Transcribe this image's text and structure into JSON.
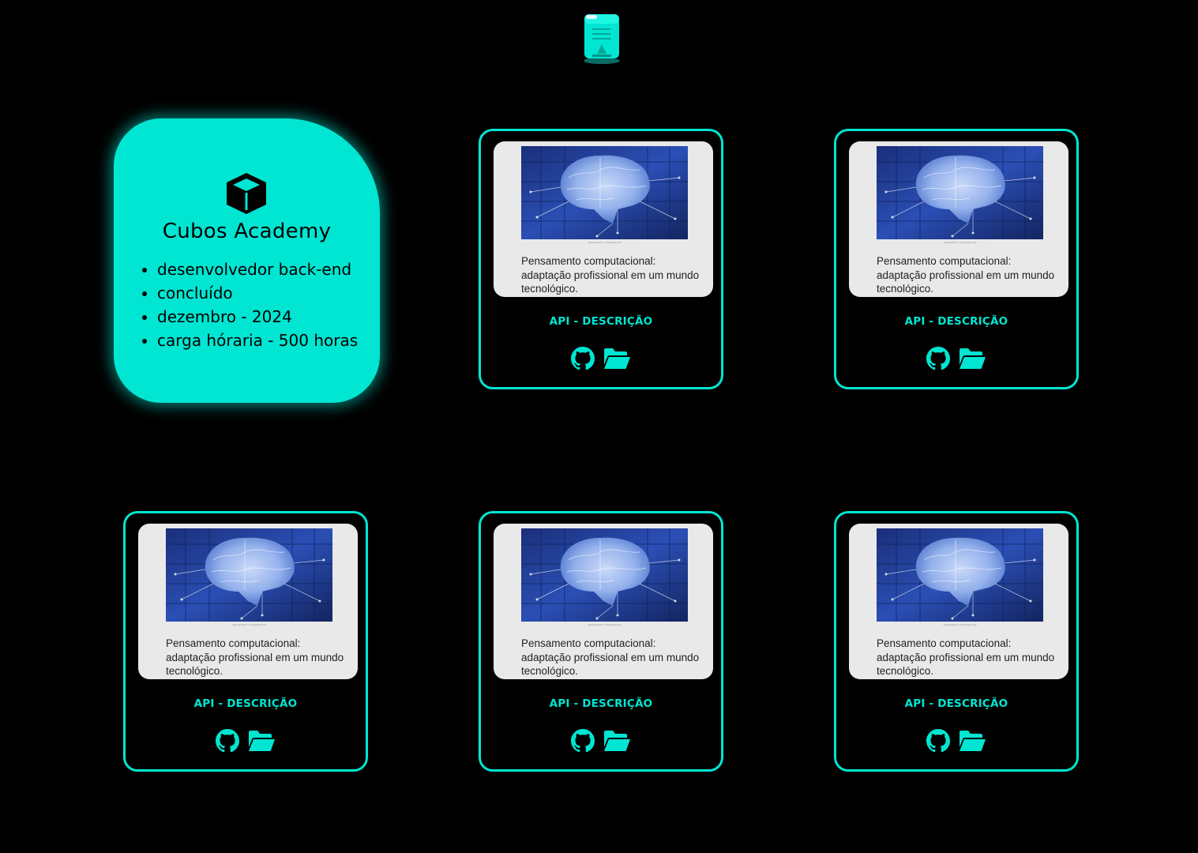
{
  "colors": {
    "background": "#000000",
    "accent": "#00e6d2",
    "text_dark": "#000000"
  },
  "header": {
    "logo_icon": "certificate-scroll-icon"
  },
  "course": {
    "icon": "cube-icon",
    "title": "Cubos Academy",
    "details": [
      "desenvolvedor back-end",
      "concluído",
      "dezembro - 2024",
      "carga hóraria - 500 horas"
    ]
  },
  "projects": [
    {
      "thumbnail_caption": "Pensamento computacional: adaptação profissional em um mundo tecnológico.",
      "title": "API - DESCRIÇÃO",
      "icons": [
        "github-icon",
        "folder-open-icon"
      ]
    },
    {
      "thumbnail_caption": "Pensamento computacional: adaptação profissional em um mundo tecnológico.",
      "title": "API - DESCRIÇÃO",
      "icons": [
        "github-icon",
        "folder-open-icon"
      ]
    },
    {
      "thumbnail_caption": "Pensamento computacional: adaptação profissional em um mundo tecnológico.",
      "title": "API - DESCRIÇÃO",
      "icons": [
        "github-icon",
        "folder-open-icon"
      ]
    },
    {
      "thumbnail_caption": "Pensamento computacional: adaptação profissional em um mundo tecnológico.",
      "title": "API - DESCRIÇÃO",
      "icons": [
        "github-icon",
        "folder-open-icon"
      ]
    },
    {
      "thumbnail_caption": "Pensamento computacional: adaptação profissional em um mundo tecnológico.",
      "title": "API - DESCRIÇÃO",
      "icons": [
        "github-icon",
        "folder-open-icon"
      ]
    }
  ]
}
